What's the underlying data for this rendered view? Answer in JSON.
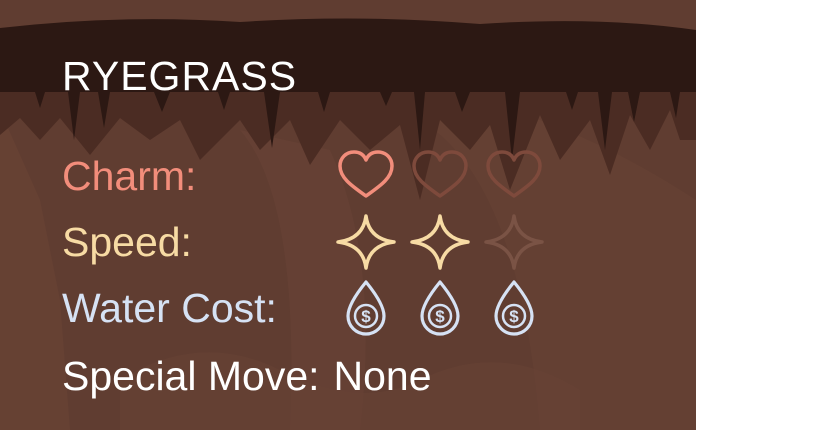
{
  "title": "RYEGRASS",
  "stats": {
    "charm": {
      "label": "Charm:",
      "filled": 1,
      "max": 3,
      "icon": "heart-icon"
    },
    "speed": {
      "label": "Speed:",
      "filled": 2,
      "max": 3,
      "icon": "sparkle-icon"
    },
    "water_cost": {
      "label": "Water Cost:",
      "filled": 3,
      "max": 3,
      "icon": "water-drop-dollar-icon",
      "glyph": "$"
    },
    "special_move": {
      "label": "Special Move:",
      "value": "None"
    }
  },
  "colors": {
    "charm": "#f28d7b",
    "speed": "#f7dba4",
    "water": "#d6e2f4",
    "text": "#ffffff",
    "card_bg": "#603d31",
    "cave_top": "#2c1813",
    "inactive_charm": "#7e4a3c",
    "inactive_speed": "#7a5345"
  }
}
